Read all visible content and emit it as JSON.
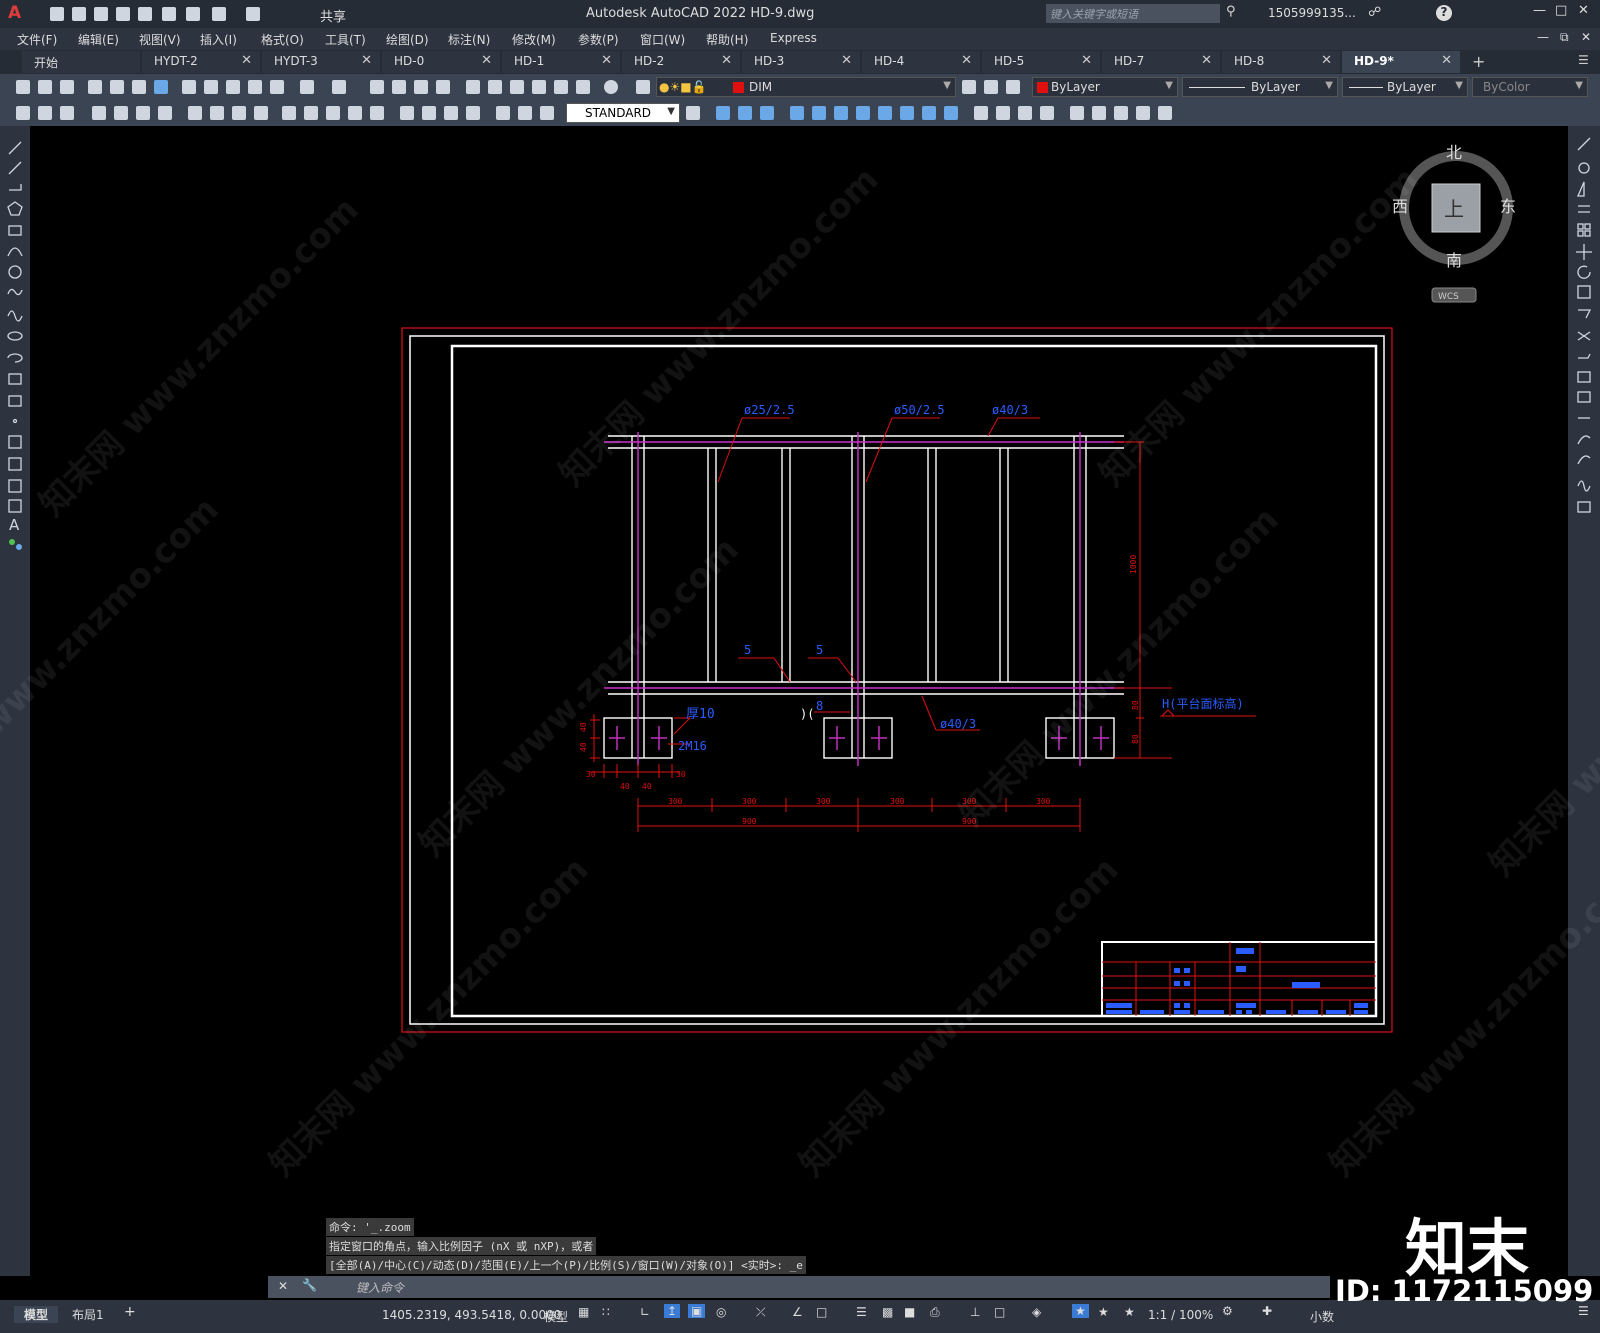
{
  "app": {
    "title": "Autodesk AutoCAD 2022    HD-9.dwg",
    "logo": "A",
    "share": "共享",
    "search_placeholder": "键入关键字或短语",
    "user": "1505999135...",
    "help": "?"
  },
  "menu": [
    "文件(F)",
    "编辑(E)",
    "视图(V)",
    "插入(I)",
    "格式(O)",
    "工具(T)",
    "绘图(D)",
    "标注(N)",
    "修改(M)",
    "参数(P)",
    "窗口(W)",
    "帮助(H)",
    "Express"
  ],
  "tabs": [
    {
      "label": "开始",
      "active": false,
      "closable": false
    },
    {
      "label": "HYDT-2",
      "active": false,
      "closable": true
    },
    {
      "label": "HYDT-3",
      "active": false,
      "closable": true
    },
    {
      "label": "HD-0",
      "active": false,
      "closable": true
    },
    {
      "label": "HD-1",
      "active": false,
      "closable": true
    },
    {
      "label": "HD-2",
      "active": false,
      "closable": true
    },
    {
      "label": "HD-3",
      "active": false,
      "closable": true
    },
    {
      "label": "HD-4",
      "active": false,
      "closable": true
    },
    {
      "label": "HD-5",
      "active": false,
      "closable": true
    },
    {
      "label": "HD-7",
      "active": false,
      "closable": true
    },
    {
      "label": "HD-8",
      "active": false,
      "closable": true
    },
    {
      "label": "HD-9*",
      "active": true,
      "closable": true
    }
  ],
  "toolbar": {
    "layer": "DIM",
    "color": "ByLayer",
    "linetype": "ByLayer",
    "lineweight": "ByLayer",
    "plotstyle": "ByColor",
    "textstyle": "STANDARD"
  },
  "viewcube": {
    "north": "北",
    "south": "南",
    "east": "东",
    "west": "西",
    "top": "上",
    "wcs": "WCS"
  },
  "drawing": {
    "labels_pipe": [
      "ø25/2.5",
      "ø50/2.5",
      "ø40/3"
    ],
    "dim_height": "1000",
    "weld1": "5",
    "weld2": "5",
    "plate": "厚10",
    "bolts": "2M16",
    "beam": "ø40/3",
    "level": "H(平台面标高)",
    "dim_80a": "80",
    "dim_80b": "80",
    "dim_40a": "40",
    "dim_40b": "40",
    "dim_40c": "40",
    "dim_40d": "40",
    "dim_30a": "30",
    "dim_30b": "30",
    "dim_300": "300",
    "dim_900a": "900",
    "dim_900b": "900",
    "weld3": "8"
  },
  "command": {
    "history": [
      "命令: '_.zoom",
      "指定窗口的角点，输入比例因子 (nX 或 nXP)，或者",
      "[全部(A)/中心(C)/动态(D)/范围(E)/上一个(P)/比例(S)/窗口(W)/对象(O)] <实时>: _e"
    ],
    "placeholder": "键入命令"
  },
  "status": {
    "model_tab": "模型",
    "layout_tab": "布局1",
    "coords": "1405.2319, 493.5418, 0.0000",
    "space": "模型",
    "scale": "1:1 / 100%",
    "units": "小数"
  },
  "brand": {
    "name": "知末",
    "id": "ID: 1172115099",
    "watermark": "知末网 www.znzmo.com"
  }
}
